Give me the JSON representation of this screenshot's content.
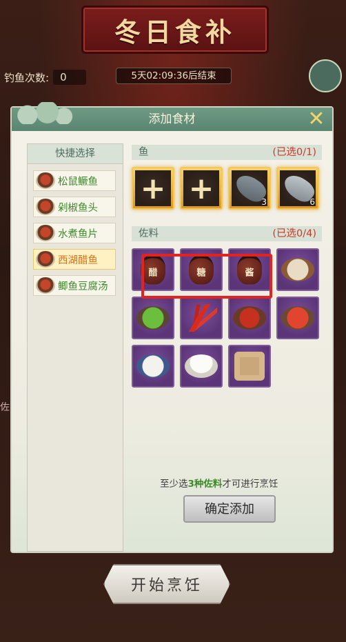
{
  "banner": {
    "title": "冬日食补"
  },
  "header": {
    "fish_count_label": "钓鱼次数:",
    "fish_count_value": "0",
    "timer": "5天02:09:36后结束"
  },
  "modal": {
    "title": "添加食材",
    "quick_select": {
      "title": "快捷选择",
      "items": [
        "松鼠鳜鱼",
        "剁椒鱼头",
        "水煮鱼片",
        "西湖醋鱼",
        "鲫鱼豆腐汤"
      ],
      "active_index": 3
    },
    "fish_section": {
      "name": "鱼",
      "count": "(已选0/1)",
      "slots": [
        {
          "type": "empty",
          "icon": "plus-icon"
        },
        {
          "type": "empty",
          "icon": "plus-icon"
        },
        {
          "type": "fish",
          "icon": "fish-icon",
          "qty": "3"
        },
        {
          "type": "fish",
          "icon": "fish-icon",
          "qty": "6"
        }
      ]
    },
    "seasoning_section": {
      "name": "佐料",
      "count": "(已选0/4)",
      "items": [
        {
          "icon": "jar-icon",
          "char": "醋"
        },
        {
          "icon": "jar-icon",
          "char": "糖"
        },
        {
          "icon": "jar-icon",
          "char": "酱"
        },
        {
          "icon": "flour-icon"
        },
        {
          "icon": "scallion-icon"
        },
        {
          "icon": "chili-icon"
        },
        {
          "icon": "sauce-icon"
        },
        {
          "icon": "chopped-chili-icon"
        },
        {
          "icon": "tofu-icon"
        },
        {
          "icon": "salt-icon"
        },
        {
          "icon": "pepper-icon"
        }
      ]
    },
    "hint": {
      "prefix": "至少选",
      "emphasis": "3种佐料",
      "suffix": "才可进行烹饪"
    },
    "confirm_label": "确定添加"
  },
  "start_label": "开始烹饪",
  "side_label": "佐"
}
